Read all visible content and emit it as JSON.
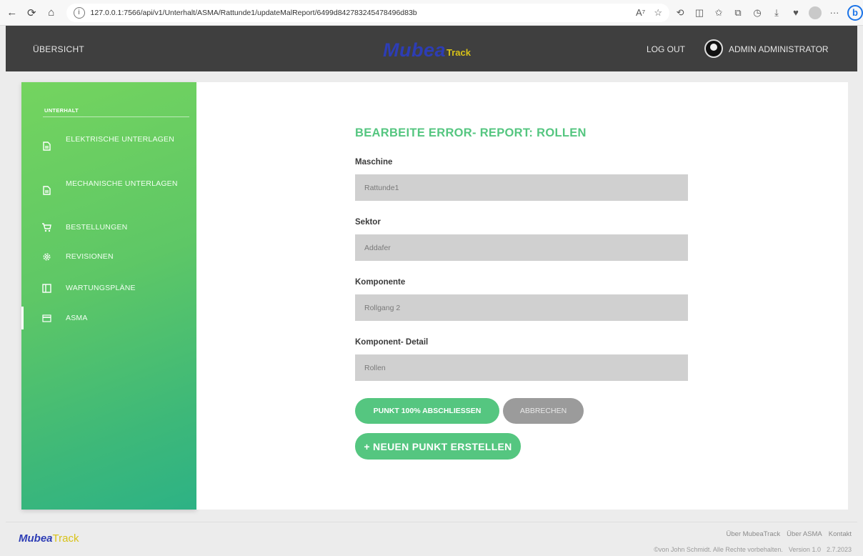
{
  "browser": {
    "url": "127.0.0.1:7566/api/v1/Unterhalt/ASMA/Rattunde1/updateMalReport/6499d842783245478496d83b",
    "read_aloud": "A⁷",
    "bing_label": "b"
  },
  "header": {
    "overview_label": "ÜBERSICHT",
    "logo_main": "Mubea",
    "logo_sub": "Track",
    "logout_label": "LOG OUT",
    "user_name": "ADMIN ADMINISTRATOR"
  },
  "sidebar": {
    "heading": "UNTERHALT",
    "items": [
      {
        "label": "ELEKTRISCHE UNTERLAGEN",
        "icon": "document-icon",
        "active": false
      },
      {
        "label": "MECHANISCHE UNTERLAGEN",
        "icon": "document-icon",
        "active": false
      },
      {
        "label": "BESTELLUNGEN",
        "icon": "cart-icon",
        "active": false
      },
      {
        "label": "REVISIONEN",
        "icon": "gear-icon",
        "active": false
      },
      {
        "label": "WARTUNGSPLÄNE",
        "icon": "columns-icon",
        "active": false
      },
      {
        "label": "ASMA",
        "icon": "card-icon",
        "active": true
      }
    ]
  },
  "form": {
    "title": "BEARBEITE ERROR- REPORT: ROLLEN",
    "fields": [
      {
        "label": "Maschine",
        "value": "Rattunde1"
      },
      {
        "label": "Sektor",
        "value": "Addafer"
      },
      {
        "label": "Komponente",
        "value": "Rollgang 2"
      },
      {
        "label": "Komponent- Detail",
        "value": "Rollen"
      }
    ],
    "complete_button": "PUNKT 100% ABSCHLIESSEN",
    "cancel_button": "ABBRECHEN",
    "new_button": "+ NEUEN PUNKT ERSTELLEN"
  },
  "footer": {
    "logo_main": "Mubea",
    "logo_sub": "Track",
    "links": [
      "Über MubeaTrack",
      "Über ASMA",
      "Kontakt"
    ],
    "copyright": "©von John Schmidt. Alle Rechte vorbehalten.",
    "version": "Version 1.0",
    "date": "2.7.2023"
  },
  "colors": {
    "accent_green": "#55c680",
    "header_dark": "#3f3f3f",
    "logo_blue": "#2d3db5",
    "logo_yellow": "#d8c218",
    "input_gray": "#d0d0d0",
    "cancel_gray": "#9b9b9b"
  }
}
